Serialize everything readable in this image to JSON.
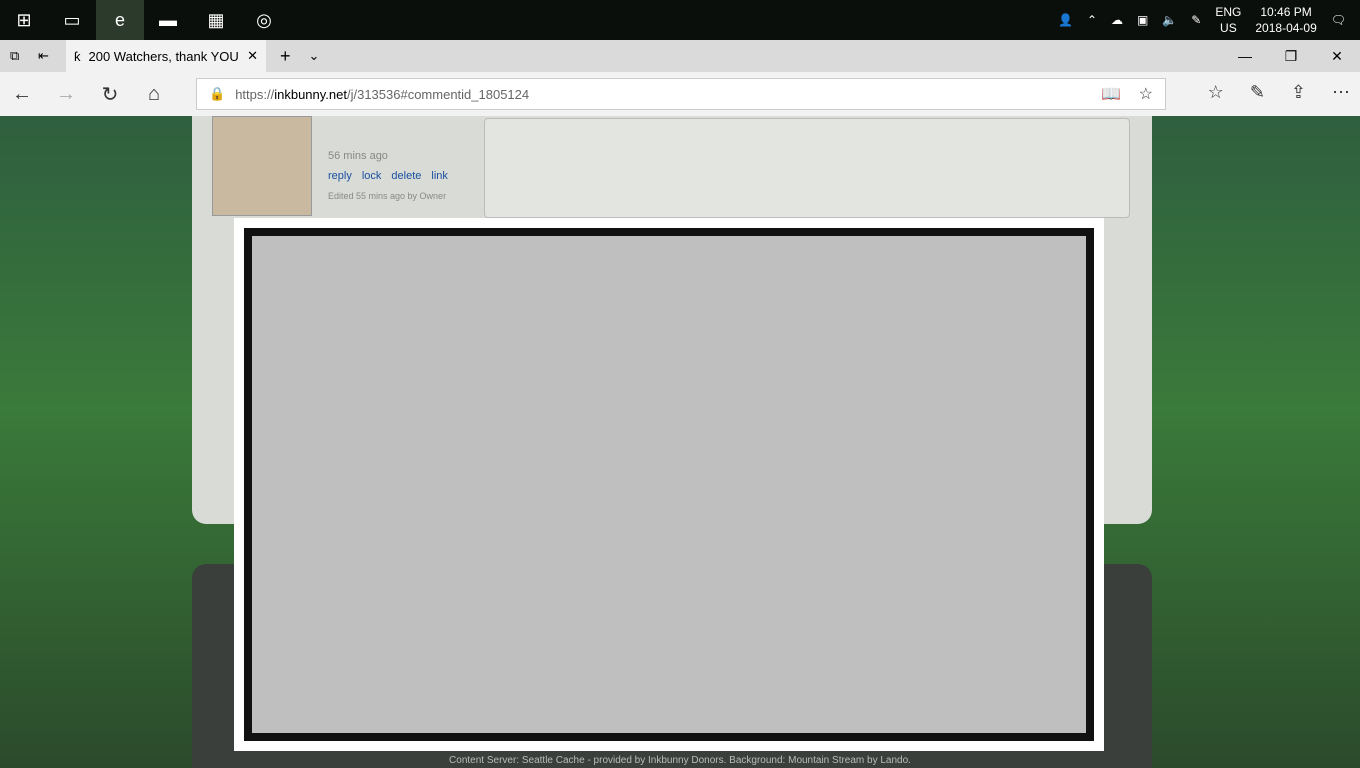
{
  "taskbar": {
    "lang": "ENG",
    "region": "US",
    "time": "10:46 PM",
    "date": "2018-04-09"
  },
  "tab": {
    "title": "200 Watchers, thank YOU"
  },
  "address": {
    "scheme": "https://",
    "host": "inkbunny.net",
    "path": "/j/313536#commentid_1805124"
  },
  "comment": {
    "time": "56 mins ago",
    "actions": [
      "reply",
      "lock",
      "delete",
      "link"
    ],
    "edited": "Edited 55 mins ago by Owner"
  },
  "footer": "Content Server: Seattle Cache - provided by Inkbunny Donors. Background: Mountain Stream by Lando."
}
